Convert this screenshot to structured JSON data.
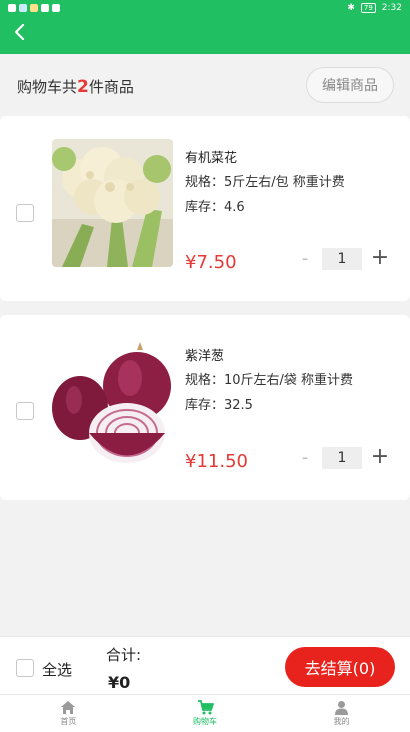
{
  "status": {
    "time": "2:32",
    "battery": "79"
  },
  "colors": {
    "brand": "#1fbf62",
    "price": "#e53935",
    "checkout": "#e8231d"
  },
  "cart": {
    "title_prefix": "购物车共",
    "count": "2",
    "title_suffix": "件商品",
    "edit_label": "编辑商品"
  },
  "items": [
    {
      "name": "有机菜花",
      "spec": "规格：5斤左右/包 称重计费",
      "stock": "库存：4.6",
      "price": "¥7.50",
      "qty": "1",
      "minus": "-",
      "plus": "+",
      "image_icon": "cauliflower-image"
    },
    {
      "name": "紫洋葱",
      "spec": "规格：10斤左右/袋 称重计费",
      "stock": "库存：32.5",
      "price": "¥11.50",
      "qty": "1",
      "minus": "-",
      "plus": "+",
      "image_icon": "red-onion-image"
    }
  ],
  "checkout": {
    "select_all": "全选",
    "total_label": "合计:",
    "total_value": "¥0",
    "button": "去结算(0)"
  },
  "tabs": [
    {
      "label": "首页",
      "icon": "home-icon",
      "active": false
    },
    {
      "label": "购物车",
      "icon": "cart-icon",
      "active": true
    },
    {
      "label": "我的",
      "icon": "user-icon",
      "active": false
    }
  ]
}
